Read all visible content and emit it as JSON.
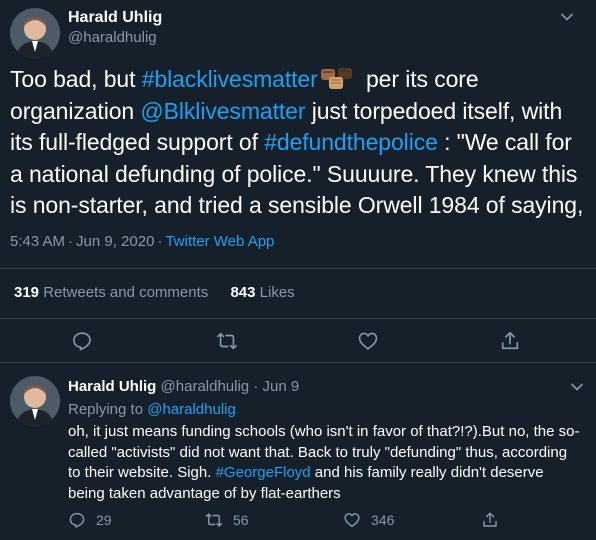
{
  "main": {
    "name": "Harald Uhlig",
    "handle": "@haraldhulig",
    "text_1": "Too bad, but ",
    "hashtag_1": "#blacklivesmatter",
    "text_2": " per its core organization ",
    "mention_1": "@Blklivesmatter",
    "text_3": " just torpedoed itself, with its full-fledged support of ",
    "hashtag_2": "#defundthepolice",
    "text_4": " : \"We call for a national defunding of police.\"  Suuuure.  They knew this is non-starter, and tried a sensible Orwell 1984 of saying,",
    "time": "5:43 AM",
    "date": "Jun 9, 2020",
    "separator": "·",
    "source": "Twitter Web App",
    "retweets_count": "319",
    "retweets_label": "Retweets and comments",
    "likes_count": "843",
    "likes_label": "Likes"
  },
  "reply": {
    "name": "Harald Uhlig",
    "handle": "@haraldhulig",
    "separator": "·",
    "date": "Jun 9",
    "replying_label": "Replying to",
    "replying_to": "@haraldhulig",
    "text_1": "oh, it just means funding schools (who isn't in favor of that?!?).But no, the so-called \"activists\" did not want that. Back to truly \"defunding\" thus, according to their website.   Sigh.  ",
    "hashtag": "#GeorgeFloyd",
    "text_2": " and his family really didn't deserve being taken advantage of by flat-earthers",
    "replies": "29",
    "retweets": "56",
    "likes": "346"
  },
  "icons": {
    "reply": "reply-icon",
    "retweet": "retweet-icon",
    "like": "heart-icon",
    "share": "share-icon",
    "menu": "chevron-down-icon",
    "emoji": "raised-fists-emoji"
  },
  "colors": {
    "background": "#15202b",
    "link": "#1da1f2",
    "muted": "#8899a6",
    "divider": "#38444d"
  }
}
